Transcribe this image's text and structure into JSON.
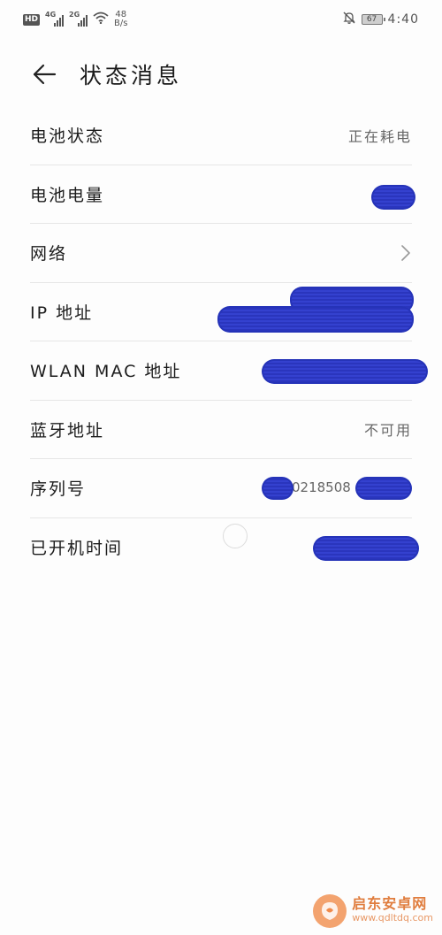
{
  "status_bar": {
    "hd_badge": "HD",
    "network1_gen": "4G",
    "network2_gen": "2G",
    "speed_value": "48",
    "speed_unit": "B/s",
    "battery_level": "67",
    "time": "4:40"
  },
  "header": {
    "title": "状态消息"
  },
  "rows": [
    {
      "label": "电池状态",
      "value": "正在耗电"
    },
    {
      "label": "电池电量",
      "value": ""
    },
    {
      "label": "网络",
      "value": ""
    },
    {
      "label": "IP 地址",
      "value": ""
    },
    {
      "label": "WLAN MAC 地址",
      "value": ""
    },
    {
      "label": "蓝牙地址",
      "value": "不可用"
    },
    {
      "label": "序列号",
      "value": "0218508"
    },
    {
      "label": "已开机时间",
      "value": ""
    }
  ],
  "watermark": {
    "name": "启东安卓网",
    "url": "www.qdltdq.com"
  },
  "colors": {
    "redaction": "#2f3bc7",
    "watermark": "#e07d3e"
  }
}
